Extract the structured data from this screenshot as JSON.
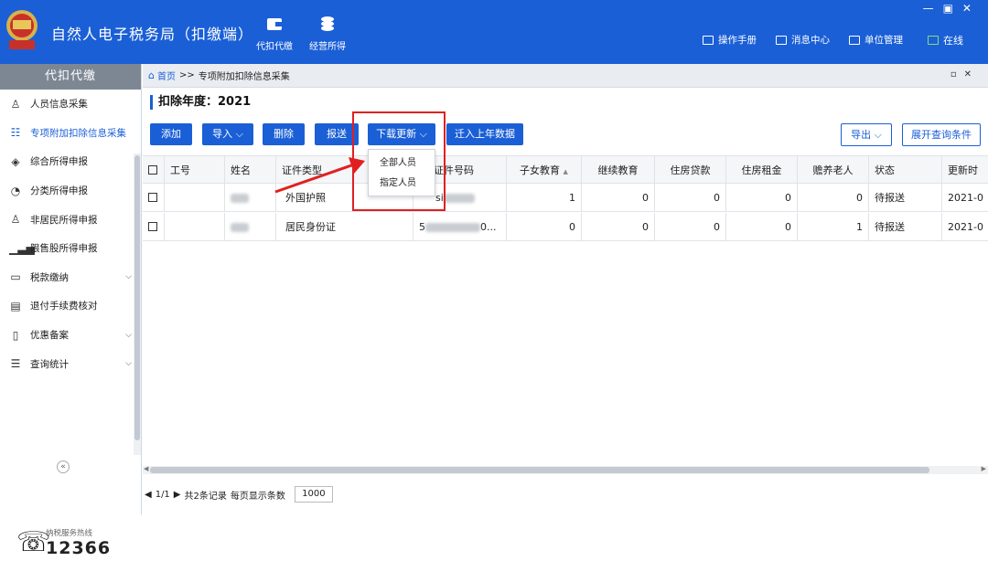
{
  "app": {
    "title": "自然人电子税务局（扣缴端）"
  },
  "topnav": [
    {
      "label": "代扣代缴"
    },
    {
      "label": "经营所得"
    }
  ],
  "toplinks": {
    "manual": "操作手册",
    "messages": "消息中心",
    "unit": "单位管理",
    "online": "在线"
  },
  "sidebar": {
    "header": "代扣代缴",
    "items": [
      {
        "label": "人员信息采集"
      },
      {
        "label": "专项附加扣除信息采集"
      },
      {
        "label": "综合所得申报"
      },
      {
        "label": "分类所得申报"
      },
      {
        "label": "非居民所得申报"
      },
      {
        "label": "限售股所得申报"
      },
      {
        "label": "税款缴纳"
      },
      {
        "label": "退付手续费核对"
      },
      {
        "label": "优惠备案"
      },
      {
        "label": "查询统计"
      }
    ],
    "hotline_label": "纳税服务热线",
    "hotline_number": "12366"
  },
  "breadcrumb": {
    "home": "首页",
    "sep": ">>",
    "current": "专项附加扣除信息采集"
  },
  "year_title": "扣除年度：2021",
  "toolbar": {
    "add": "添加",
    "import": "导入",
    "delete": "删除",
    "submit": "报送",
    "download": "下载更新",
    "carry": "迁入上年数据",
    "export": "导出",
    "expand": "展开查询条件"
  },
  "dropdown": [
    "全部人员",
    "指定人员"
  ],
  "table": {
    "headers": [
      "工号",
      "姓名",
      "证件类型",
      "证件号码",
      "子女教育",
      "继续教育",
      "住房贷款",
      "住房租金",
      "赡养老人",
      "状态",
      "更新时"
    ],
    "rows": [
      {
        "id": "",
        "name": "",
        "doc_type": "外国护照",
        "doc_no": "si",
        "edu_child": "1",
        "edu_cont": "0",
        "loan": "0",
        "rent": "0",
        "elder": "0",
        "status": "待报送",
        "updated": "2021-0"
      },
      {
        "id": "",
        "name": "",
        "doc_type": "居民身份证",
        "doc_no": "5",
        "doc_no_tail": "0...",
        "edu_child": "0",
        "edu_cont": "0",
        "loan": "0",
        "rent": "0",
        "elder": "1",
        "status": "待报送",
        "updated": "2021-0"
      }
    ]
  },
  "pager": {
    "pages": "1/1",
    "total": "共2条记录",
    "per_page_label": "每页显示条数",
    "per_page": "1000"
  },
  "colors": {
    "primary": "#1a5fd6",
    "highlight": "#e02020"
  }
}
